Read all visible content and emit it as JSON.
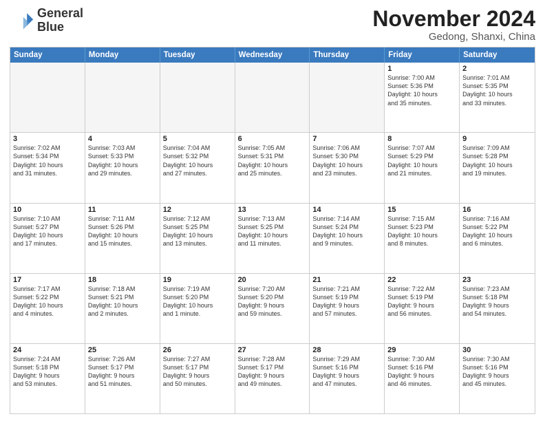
{
  "logo": {
    "line1": "General",
    "line2": "Blue"
  },
  "title": "November 2024",
  "location": "Gedong, Shanxi, China",
  "days_header": [
    "Sunday",
    "Monday",
    "Tuesday",
    "Wednesday",
    "Thursday",
    "Friday",
    "Saturday"
  ],
  "weeks": [
    [
      {
        "day": "",
        "info": "",
        "empty": true
      },
      {
        "day": "",
        "info": "",
        "empty": true
      },
      {
        "day": "",
        "info": "",
        "empty": true
      },
      {
        "day": "",
        "info": "",
        "empty": true
      },
      {
        "day": "",
        "info": "",
        "empty": true
      },
      {
        "day": "1",
        "info": "Sunrise: 7:00 AM\nSunset: 5:36 PM\nDaylight: 10 hours\nand 35 minutes.",
        "empty": false
      },
      {
        "day": "2",
        "info": "Sunrise: 7:01 AM\nSunset: 5:35 PM\nDaylight: 10 hours\nand 33 minutes.",
        "empty": false
      }
    ],
    [
      {
        "day": "3",
        "info": "Sunrise: 7:02 AM\nSunset: 5:34 PM\nDaylight: 10 hours\nand 31 minutes.",
        "empty": false
      },
      {
        "day": "4",
        "info": "Sunrise: 7:03 AM\nSunset: 5:33 PM\nDaylight: 10 hours\nand 29 minutes.",
        "empty": false
      },
      {
        "day": "5",
        "info": "Sunrise: 7:04 AM\nSunset: 5:32 PM\nDaylight: 10 hours\nand 27 minutes.",
        "empty": false
      },
      {
        "day": "6",
        "info": "Sunrise: 7:05 AM\nSunset: 5:31 PM\nDaylight: 10 hours\nand 25 minutes.",
        "empty": false
      },
      {
        "day": "7",
        "info": "Sunrise: 7:06 AM\nSunset: 5:30 PM\nDaylight: 10 hours\nand 23 minutes.",
        "empty": false
      },
      {
        "day": "8",
        "info": "Sunrise: 7:07 AM\nSunset: 5:29 PM\nDaylight: 10 hours\nand 21 minutes.",
        "empty": false
      },
      {
        "day": "9",
        "info": "Sunrise: 7:09 AM\nSunset: 5:28 PM\nDaylight: 10 hours\nand 19 minutes.",
        "empty": false
      }
    ],
    [
      {
        "day": "10",
        "info": "Sunrise: 7:10 AM\nSunset: 5:27 PM\nDaylight: 10 hours\nand 17 minutes.",
        "empty": false
      },
      {
        "day": "11",
        "info": "Sunrise: 7:11 AM\nSunset: 5:26 PM\nDaylight: 10 hours\nand 15 minutes.",
        "empty": false
      },
      {
        "day": "12",
        "info": "Sunrise: 7:12 AM\nSunset: 5:25 PM\nDaylight: 10 hours\nand 13 minutes.",
        "empty": false
      },
      {
        "day": "13",
        "info": "Sunrise: 7:13 AM\nSunset: 5:25 PM\nDaylight: 10 hours\nand 11 minutes.",
        "empty": false
      },
      {
        "day": "14",
        "info": "Sunrise: 7:14 AM\nSunset: 5:24 PM\nDaylight: 10 hours\nand 9 minutes.",
        "empty": false
      },
      {
        "day": "15",
        "info": "Sunrise: 7:15 AM\nSunset: 5:23 PM\nDaylight: 10 hours\nand 8 minutes.",
        "empty": false
      },
      {
        "day": "16",
        "info": "Sunrise: 7:16 AM\nSunset: 5:22 PM\nDaylight: 10 hours\nand 6 minutes.",
        "empty": false
      }
    ],
    [
      {
        "day": "17",
        "info": "Sunrise: 7:17 AM\nSunset: 5:22 PM\nDaylight: 10 hours\nand 4 minutes.",
        "empty": false
      },
      {
        "day": "18",
        "info": "Sunrise: 7:18 AM\nSunset: 5:21 PM\nDaylight: 10 hours\nand 2 minutes.",
        "empty": false
      },
      {
        "day": "19",
        "info": "Sunrise: 7:19 AM\nSunset: 5:20 PM\nDaylight: 10 hours\nand 1 minute.",
        "empty": false
      },
      {
        "day": "20",
        "info": "Sunrise: 7:20 AM\nSunset: 5:20 PM\nDaylight: 9 hours\nand 59 minutes.",
        "empty": false
      },
      {
        "day": "21",
        "info": "Sunrise: 7:21 AM\nSunset: 5:19 PM\nDaylight: 9 hours\nand 57 minutes.",
        "empty": false
      },
      {
        "day": "22",
        "info": "Sunrise: 7:22 AM\nSunset: 5:19 PM\nDaylight: 9 hours\nand 56 minutes.",
        "empty": false
      },
      {
        "day": "23",
        "info": "Sunrise: 7:23 AM\nSunset: 5:18 PM\nDaylight: 9 hours\nand 54 minutes.",
        "empty": false
      }
    ],
    [
      {
        "day": "24",
        "info": "Sunrise: 7:24 AM\nSunset: 5:18 PM\nDaylight: 9 hours\nand 53 minutes.",
        "empty": false
      },
      {
        "day": "25",
        "info": "Sunrise: 7:26 AM\nSunset: 5:17 PM\nDaylight: 9 hours\nand 51 minutes.",
        "empty": false
      },
      {
        "day": "26",
        "info": "Sunrise: 7:27 AM\nSunset: 5:17 PM\nDaylight: 9 hours\nand 50 minutes.",
        "empty": false
      },
      {
        "day": "27",
        "info": "Sunrise: 7:28 AM\nSunset: 5:17 PM\nDaylight: 9 hours\nand 49 minutes.",
        "empty": false
      },
      {
        "day": "28",
        "info": "Sunrise: 7:29 AM\nSunset: 5:16 PM\nDaylight: 9 hours\nand 47 minutes.",
        "empty": false
      },
      {
        "day": "29",
        "info": "Sunrise: 7:30 AM\nSunset: 5:16 PM\nDaylight: 9 hours\nand 46 minutes.",
        "empty": false
      },
      {
        "day": "30",
        "info": "Sunrise: 7:30 AM\nSunset: 5:16 PM\nDaylight: 9 hours\nand 45 minutes.",
        "empty": false
      }
    ]
  ]
}
